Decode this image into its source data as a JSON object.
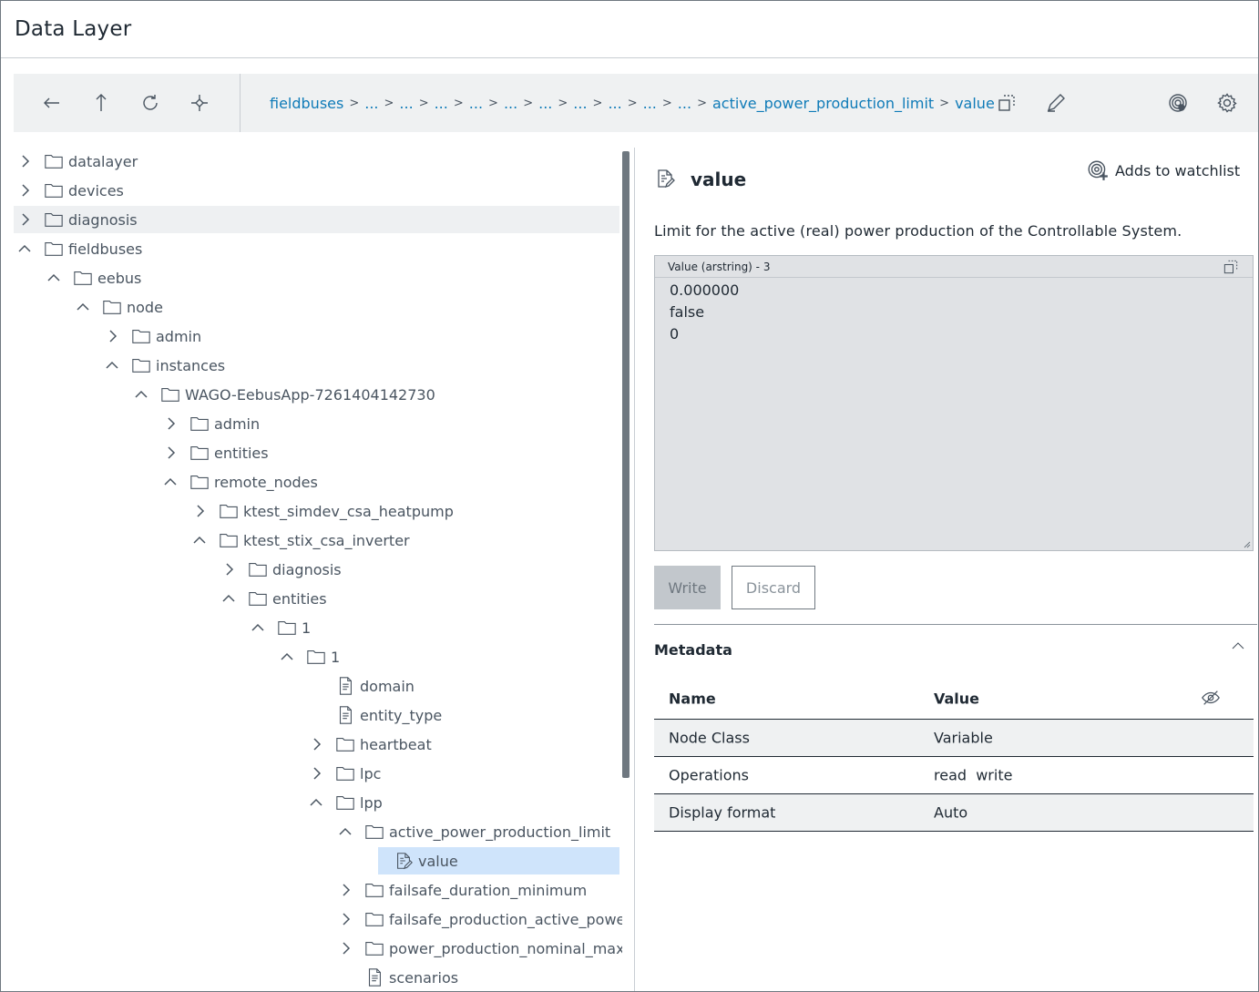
{
  "app": {
    "title": "Data Layer"
  },
  "toolbar": {
    "breadcrumbs": [
      "fieldbuses",
      "...",
      "...",
      "...",
      "...",
      "...",
      "...",
      "...",
      "...",
      "...",
      "...",
      "active_power_production_limit",
      "value"
    ],
    "separator": ">"
  },
  "tree": {
    "items": [
      {
        "label": "datalayer",
        "depth": 0,
        "chevron": "right",
        "icon": "folder-icon"
      },
      {
        "label": "devices",
        "depth": 0,
        "chevron": "right",
        "icon": "folder-icon"
      },
      {
        "label": "diagnosis",
        "depth": 0,
        "chevron": "right",
        "icon": "folder-icon",
        "state": "hover"
      },
      {
        "label": "fieldbuses",
        "depth": 0,
        "chevron": "up",
        "icon": "folder-icon"
      },
      {
        "label": "eebus",
        "depth": 1,
        "chevron": "up",
        "icon": "folder-icon"
      },
      {
        "label": "node",
        "depth": 2,
        "chevron": "up",
        "icon": "folder-icon"
      },
      {
        "label": "admin",
        "depth": 3,
        "chevron": "right",
        "icon": "folder-icon"
      },
      {
        "label": "instances",
        "depth": 3,
        "chevron": "up",
        "icon": "folder-icon"
      },
      {
        "label": "WAGO-EebusApp-7261404142730",
        "depth": 4,
        "chevron": "up",
        "icon": "folder-icon"
      },
      {
        "label": "admin",
        "depth": 5,
        "chevron": "right",
        "icon": "folder-icon"
      },
      {
        "label": "entities",
        "depth": 5,
        "chevron": "right",
        "icon": "folder-icon"
      },
      {
        "label": "remote_nodes",
        "depth": 5,
        "chevron": "up",
        "icon": "folder-icon"
      },
      {
        "label": "ktest_simdev_csa_heatpump",
        "depth": 6,
        "chevron": "right",
        "icon": "folder-icon"
      },
      {
        "label": "ktest_stix_csa_inverter",
        "depth": 6,
        "chevron": "up",
        "icon": "folder-icon"
      },
      {
        "label": "diagnosis",
        "depth": 7,
        "chevron": "right",
        "icon": "folder-icon"
      },
      {
        "label": "entities",
        "depth": 7,
        "chevron": "up",
        "icon": "folder-icon"
      },
      {
        "label": "1",
        "depth": 8,
        "chevron": "up",
        "icon": "folder-icon"
      },
      {
        "label": "1",
        "depth": 9,
        "chevron": "up",
        "icon": "folder-icon"
      },
      {
        "label": "domain",
        "depth": 10,
        "chevron": "none",
        "icon": "document-icon"
      },
      {
        "label": "entity_type",
        "depth": 10,
        "chevron": "none",
        "icon": "document-icon"
      },
      {
        "label": "heartbeat",
        "depth": 10,
        "chevron": "right",
        "icon": "folder-icon"
      },
      {
        "label": "lpc",
        "depth": 10,
        "chevron": "right",
        "icon": "folder-icon"
      },
      {
        "label": "lpp",
        "depth": 10,
        "chevron": "up",
        "icon": "folder-icon"
      },
      {
        "label": "active_power_production_limit",
        "depth": 11,
        "chevron": "up",
        "icon": "folder-icon"
      },
      {
        "label": "value",
        "depth": 12,
        "chevron": "none",
        "icon": "edit-document-icon",
        "state": "selected"
      },
      {
        "label": "failsafe_duration_minimum",
        "depth": 11,
        "chevron": "right",
        "icon": "folder-icon"
      },
      {
        "label": "failsafe_production_active_power_l",
        "depth": 11,
        "chevron": "right",
        "icon": "folder-icon"
      },
      {
        "label": "power_production_nominal_max",
        "depth": 11,
        "chevron": "right",
        "icon": "folder-icon"
      },
      {
        "label": "scenarios",
        "depth": 11,
        "chevron": "none",
        "icon": "document-icon"
      }
    ]
  },
  "detail": {
    "title": "value",
    "watchlist_label": "Adds to watchlist",
    "description": "Limit for the active (real) power production of the Controllable System.",
    "value_header": "Value (arstring) - 3",
    "value_lines": [
      "0.000000",
      "false",
      "0"
    ],
    "write_label": "Write",
    "discard_label": "Discard"
  },
  "metadata": {
    "title": "Metadata",
    "columns": [
      "Name",
      "Value"
    ],
    "rows": [
      {
        "name": "Node Class",
        "value": "Variable"
      },
      {
        "name": "Operations",
        "value": "read  write"
      },
      {
        "name": "Display format",
        "value": "Auto"
      }
    ]
  },
  "colors": {
    "accent": "#0f7bb8",
    "selected_bg": "#cfe4fb",
    "hover_bg": "#eef0f2",
    "toolbar_bg": "#eff1f2"
  }
}
